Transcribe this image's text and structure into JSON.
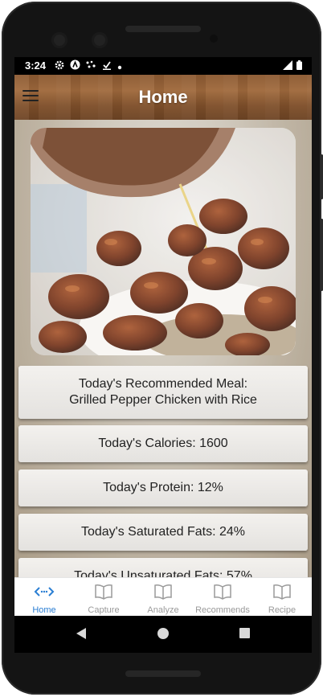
{
  "status_bar": {
    "time": "3:24"
  },
  "app_bar": {
    "title": "Home"
  },
  "cards": {
    "meal_line1": "Today's Recommended Meal:",
    "meal_line2": "Grilled Pepper Chicken with Rice",
    "calories": "Today's Calories: 1600",
    "protein": "Today's Protein: 12%",
    "saturated_fats": "Today's Saturated Fats: 24%",
    "unsaturated_fats": "Today's Unsaturated Fats: 57%"
  },
  "bottom_nav": {
    "items": [
      {
        "label": "Home",
        "icon": "code-arrows-icon",
        "active": true
      },
      {
        "label": "Capture",
        "icon": "book-icon",
        "active": false
      },
      {
        "label": "Analyze",
        "icon": "book-icon",
        "active": false
      },
      {
        "label": "Recommends",
        "icon": "book-icon",
        "active": false
      },
      {
        "label": "Recipe",
        "icon": "book-icon",
        "active": false
      }
    ]
  },
  "colors": {
    "accent": "#2a7ed3",
    "inactive": "#9a9a9a",
    "appbar_wood": "#8c5a32"
  }
}
